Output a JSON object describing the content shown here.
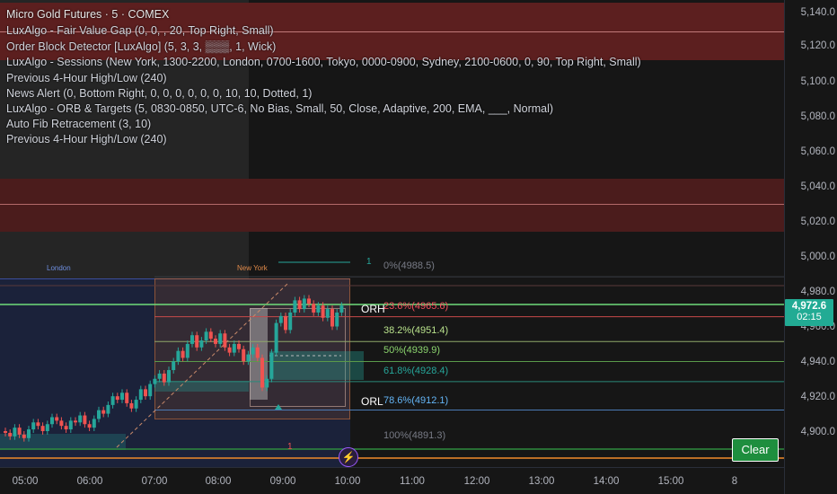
{
  "indicators": {
    "title": "Micro Gold Futures · 5 · COMEX",
    "lines": [
      "LuxAlgo - Fair Value Gap (0, 0, , 20, Top Right, Small)",
      "Order Block Detector [LuxAlgo] (5, 3, 3, ▒▒▒, 1, Wick)",
      "LuxAlgo - Sessions (New York, 1300-2200, London, 0700-1600, Tokyo, 0000-0900, Sydney, 2100-0600, 0, 90, Top Right, Small)",
      "Previous 4-Hour High/Low  (240)",
      "News Alert (0, Bottom Right, 0, 0, 0, 0, 0, 0, 10, 10, Dotted, 1)",
      "LuxAlgo - ORB & Targets (5, 0830-0850, UTC-6, No Bias, Small, 50, Close, Adaptive, 200, EMA, ___, Normal)",
      "Auto Fib Retracement (3, 10)",
      "Previous 4-Hour High/Low  (240)"
    ]
  },
  "price_axis": {
    "ticks": [
      "5,140.0",
      "5,120.0",
      "5,100.0",
      "5,080.0",
      "5,060.0",
      "5,040.0",
      "5,020.0",
      "5,000.0",
      "4,980.0",
      "4,960.0",
      "4,940.0",
      "4,920.0",
      "4,900.0"
    ],
    "last_price": "4,972.6",
    "countdown": "02:15"
  },
  "time_axis": {
    "ticks": [
      "05:00",
      "06:00",
      "07:00",
      "08:00",
      "09:00",
      "10:00",
      "11:00",
      "12:00",
      "13:00",
      "14:00",
      "15:00",
      "8"
    ]
  },
  "fib": {
    "levels": [
      {
        "label": "0%(4988.5)",
        "color": "#787b86"
      },
      {
        "label": "23.6%(4965.6)",
        "color": "#f7525f"
      },
      {
        "label": "38.2%(4951.4)",
        "color": "#b9e28c"
      },
      {
        "label": "50%(4939.9)",
        "color": "#8bd46e"
      },
      {
        "label": "61.8%(4928.4)",
        "color": "#26a69a"
      },
      {
        "label": "78.6%(4912.1)",
        "color": "#64b5f6"
      },
      {
        "label": "100%(4891.3)",
        "color": "#787b86"
      }
    ]
  },
  "orb": {
    "high_label": "ORH",
    "low_label": "ORL"
  },
  "sessions": {
    "london": "London",
    "new_york": "New York"
  },
  "markers": {
    "top_count": "1",
    "bottom_count": "1"
  },
  "buttons": {
    "clear": "Clear"
  },
  "colors": {
    "bull": "#26a69a",
    "bear": "#ef5350",
    "last_price_bg": "#22ab94"
  }
}
